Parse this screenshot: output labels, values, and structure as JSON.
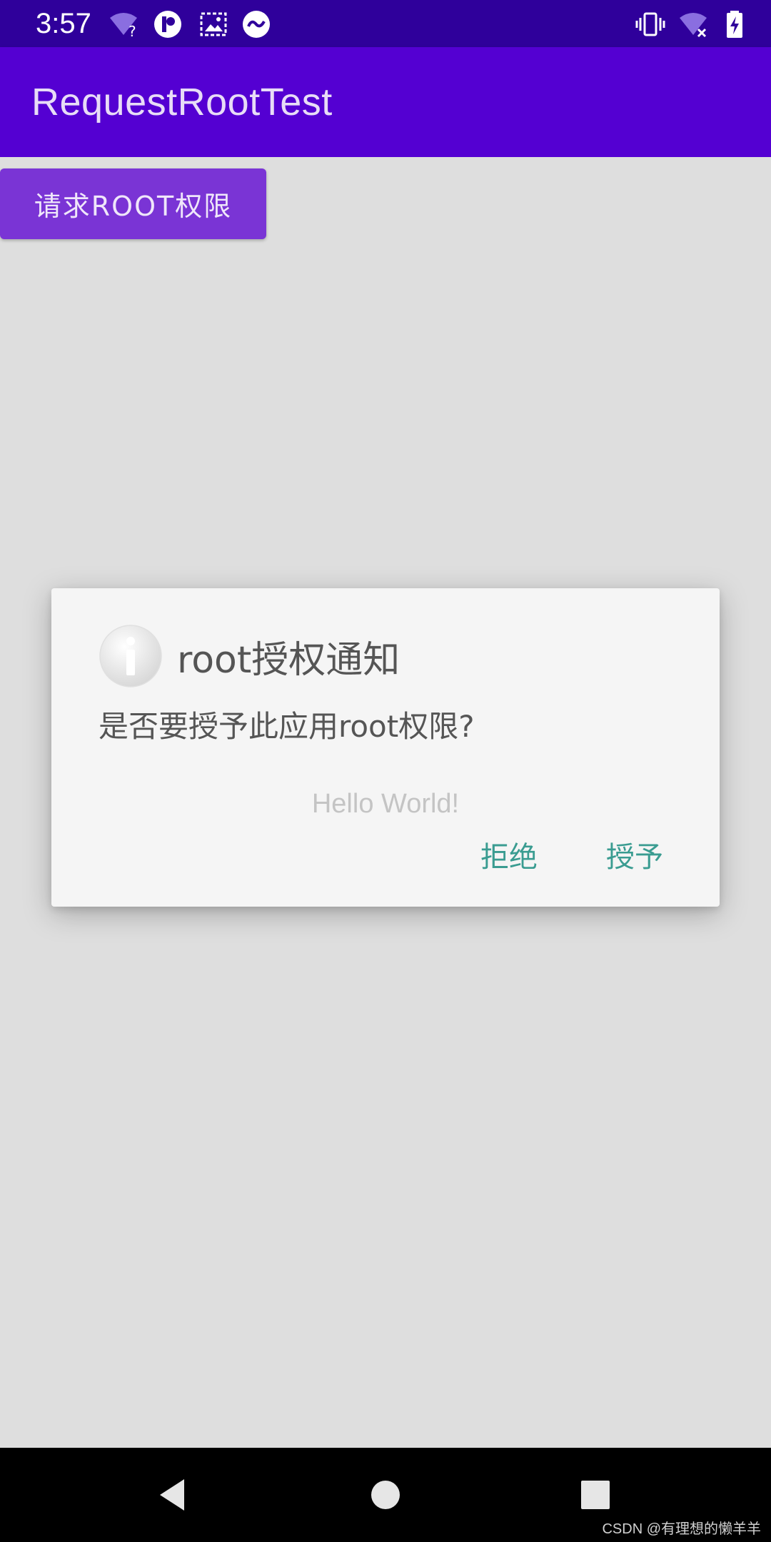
{
  "status_bar": {
    "time": "3:57",
    "left_icons": [
      "wifi-unknown-icon",
      "app-notification-icon",
      "screenshot-icon",
      "cast-icon"
    ],
    "right_icons": [
      "vibrate-icon",
      "wifi-off-icon",
      "battery-charging-icon"
    ]
  },
  "app_bar": {
    "title": "RequestRootTest"
  },
  "content": {
    "request_button_label": "请求ROOT权限"
  },
  "dialog": {
    "icon": "info-icon",
    "title": "root授权通知",
    "message": "是否要授予此应用root权限?",
    "background_text": "Hello World!",
    "deny_label": "拒绝",
    "grant_label": "授予",
    "accent_color": "#3a9c91"
  },
  "nav_bar": {
    "buttons": [
      "back-icon",
      "home-icon",
      "recents-icon"
    ]
  },
  "watermark": "CSDN @有理想的懒羊羊",
  "colors": {
    "status_bar": "#2f009b",
    "app_bar": "#5400d2",
    "button": "#7a34d5",
    "background": "#dedede"
  }
}
